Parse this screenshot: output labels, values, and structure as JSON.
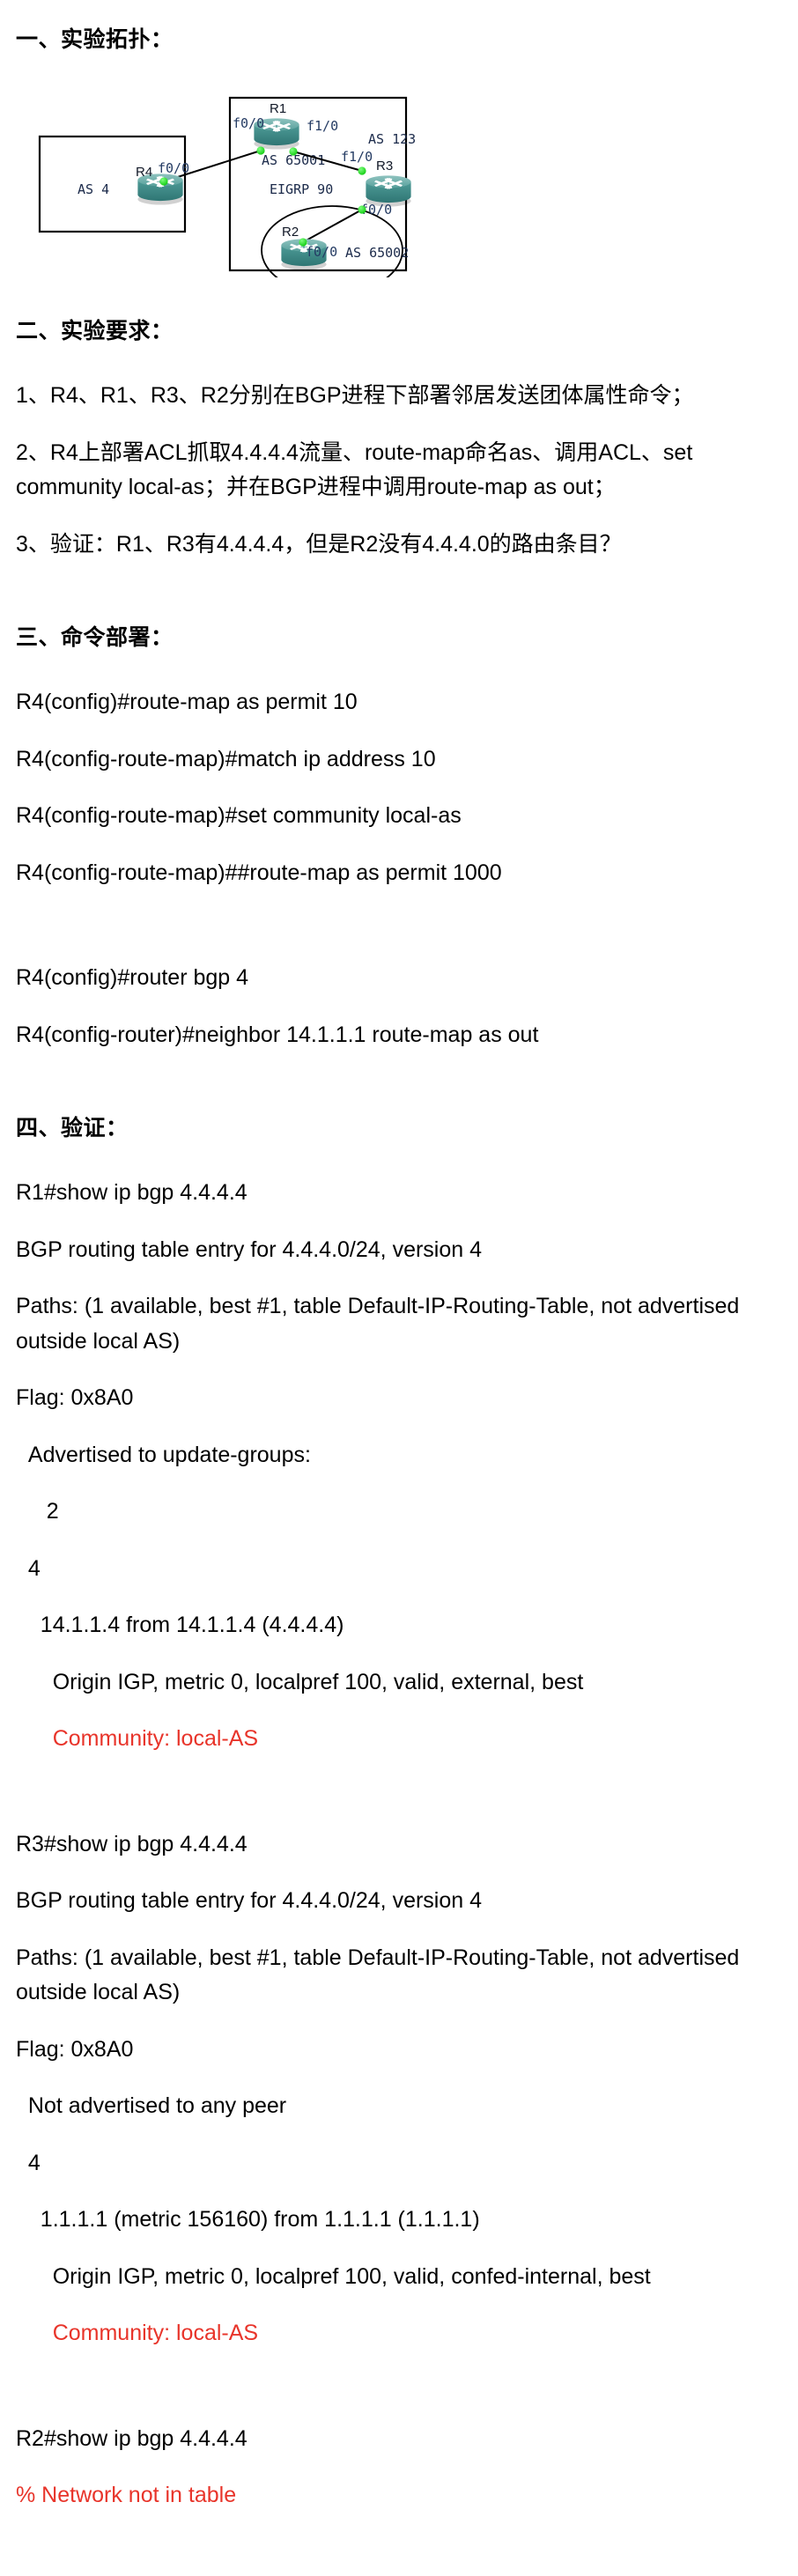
{
  "sections": {
    "topology": {
      "heading": "一、实验拓扑："
    },
    "requirements": {
      "heading": "二、实验要求：",
      "items": [
        "1、R4、R1、R3、R2分别在BGP进程下部署邻居发送团体属性命令；",
        "2、R4上部署ACL抓取4.4.4.4流量、route-map命名as、调用ACL、set community local-as；并在BGP进程中调用route-map as out；",
        "3、验证：R1、R3有4.4.4.4，但是R2没有4.4.4.0的路由条目？"
      ]
    },
    "commands": {
      "heading": "三、命令部署：",
      "lines": [
        "R4(config)#route-map as permit 10",
        "R4(config-route-map)#match ip address 10",
        "R4(config-route-map)#set community local-as",
        "R4(config-route-map)##route-map as permit 1000",
        "",
        "R4(config)#router bgp 4",
        "R4(config-router)#neighbor 14.1.1.1 route-map as out"
      ]
    },
    "verification": {
      "heading": "四、验证：",
      "blocks": [
        {
          "lines": [
            {
              "text": "R1#show ip bgp 4.4.4.4",
              "color": "black"
            },
            {
              "text": "BGP routing table entry for 4.4.4.0/24, version 4",
              "color": "black"
            },
            {
              "text": "Paths: (1 available, best #1, table Default-IP-Routing-Table, not advertised outside local AS)",
              "color": "black"
            },
            {
              "text": "Flag: 0x8A0",
              "color": "black"
            },
            {
              "text": "  Advertised to update-groups:",
              "color": "black"
            },
            {
              "text": "     2",
              "color": "black"
            },
            {
              "text": "  4",
              "color": "black"
            },
            {
              "text": "    14.1.1.4 from 14.1.1.4 (4.4.4.4)",
              "color": "black"
            },
            {
              "text": "      Origin IGP, metric 0, localpref 100, valid, external, best",
              "color": "black"
            },
            {
              "text": "      Community: local-AS",
              "color": "red"
            }
          ]
        },
        {
          "lines": [
            {
              "text": "R3#show ip bgp 4.4.4.4",
              "color": "black"
            },
            {
              "text": "BGP routing table entry for 4.4.4.0/24, version 4",
              "color": "black"
            },
            {
              "text": "Paths: (1 available, best #1, table Default-IP-Routing-Table, not advertised outside local AS)",
              "color": "black"
            },
            {
              "text": "Flag: 0x8A0",
              "color": "black"
            },
            {
              "text": "  Not advertised to any peer",
              "color": "black"
            },
            {
              "text": "  4",
              "color": "black"
            },
            {
              "text": "    1.1.1.1 (metric 156160) from 1.1.1.1 (1.1.1.1)",
              "color": "black"
            },
            {
              "text": "      Origin IGP, metric 0, localpref 100, valid, confed-internal, best",
              "color": "black"
            },
            {
              "text": "      Community: local-AS",
              "color": "red"
            }
          ]
        },
        {
          "lines": [
            {
              "text": "R2#show ip bgp 4.4.4.4",
              "color": "black"
            },
            {
              "text": "% Network not in table",
              "color": "red"
            }
          ]
        }
      ]
    }
  },
  "diagram": {
    "as4_box_label": "AS 4",
    "as123_box_label": "AS 123",
    "as65001_label": "AS 65001",
    "as65002_label": "AS 65002",
    "eigrp_label": "EIGRP 90",
    "routers": [
      {
        "name": "R4",
        "port": "f0/0"
      },
      {
        "name": "R1",
        "port_left": "f0/0",
        "port_right": "f1/0"
      },
      {
        "name": "R3",
        "port_top": "f1/0",
        "port_bottom": "f0/0"
      },
      {
        "name": "R2",
        "port": "f0/0"
      }
    ],
    "colors": {
      "router_body": "#3a8b89",
      "router_top": "#63a8a4",
      "link_dot": "#22dd22",
      "border": "#000000",
      "label_text": "#1b2a4a",
      "accent_red": "#e8342a"
    }
  }
}
